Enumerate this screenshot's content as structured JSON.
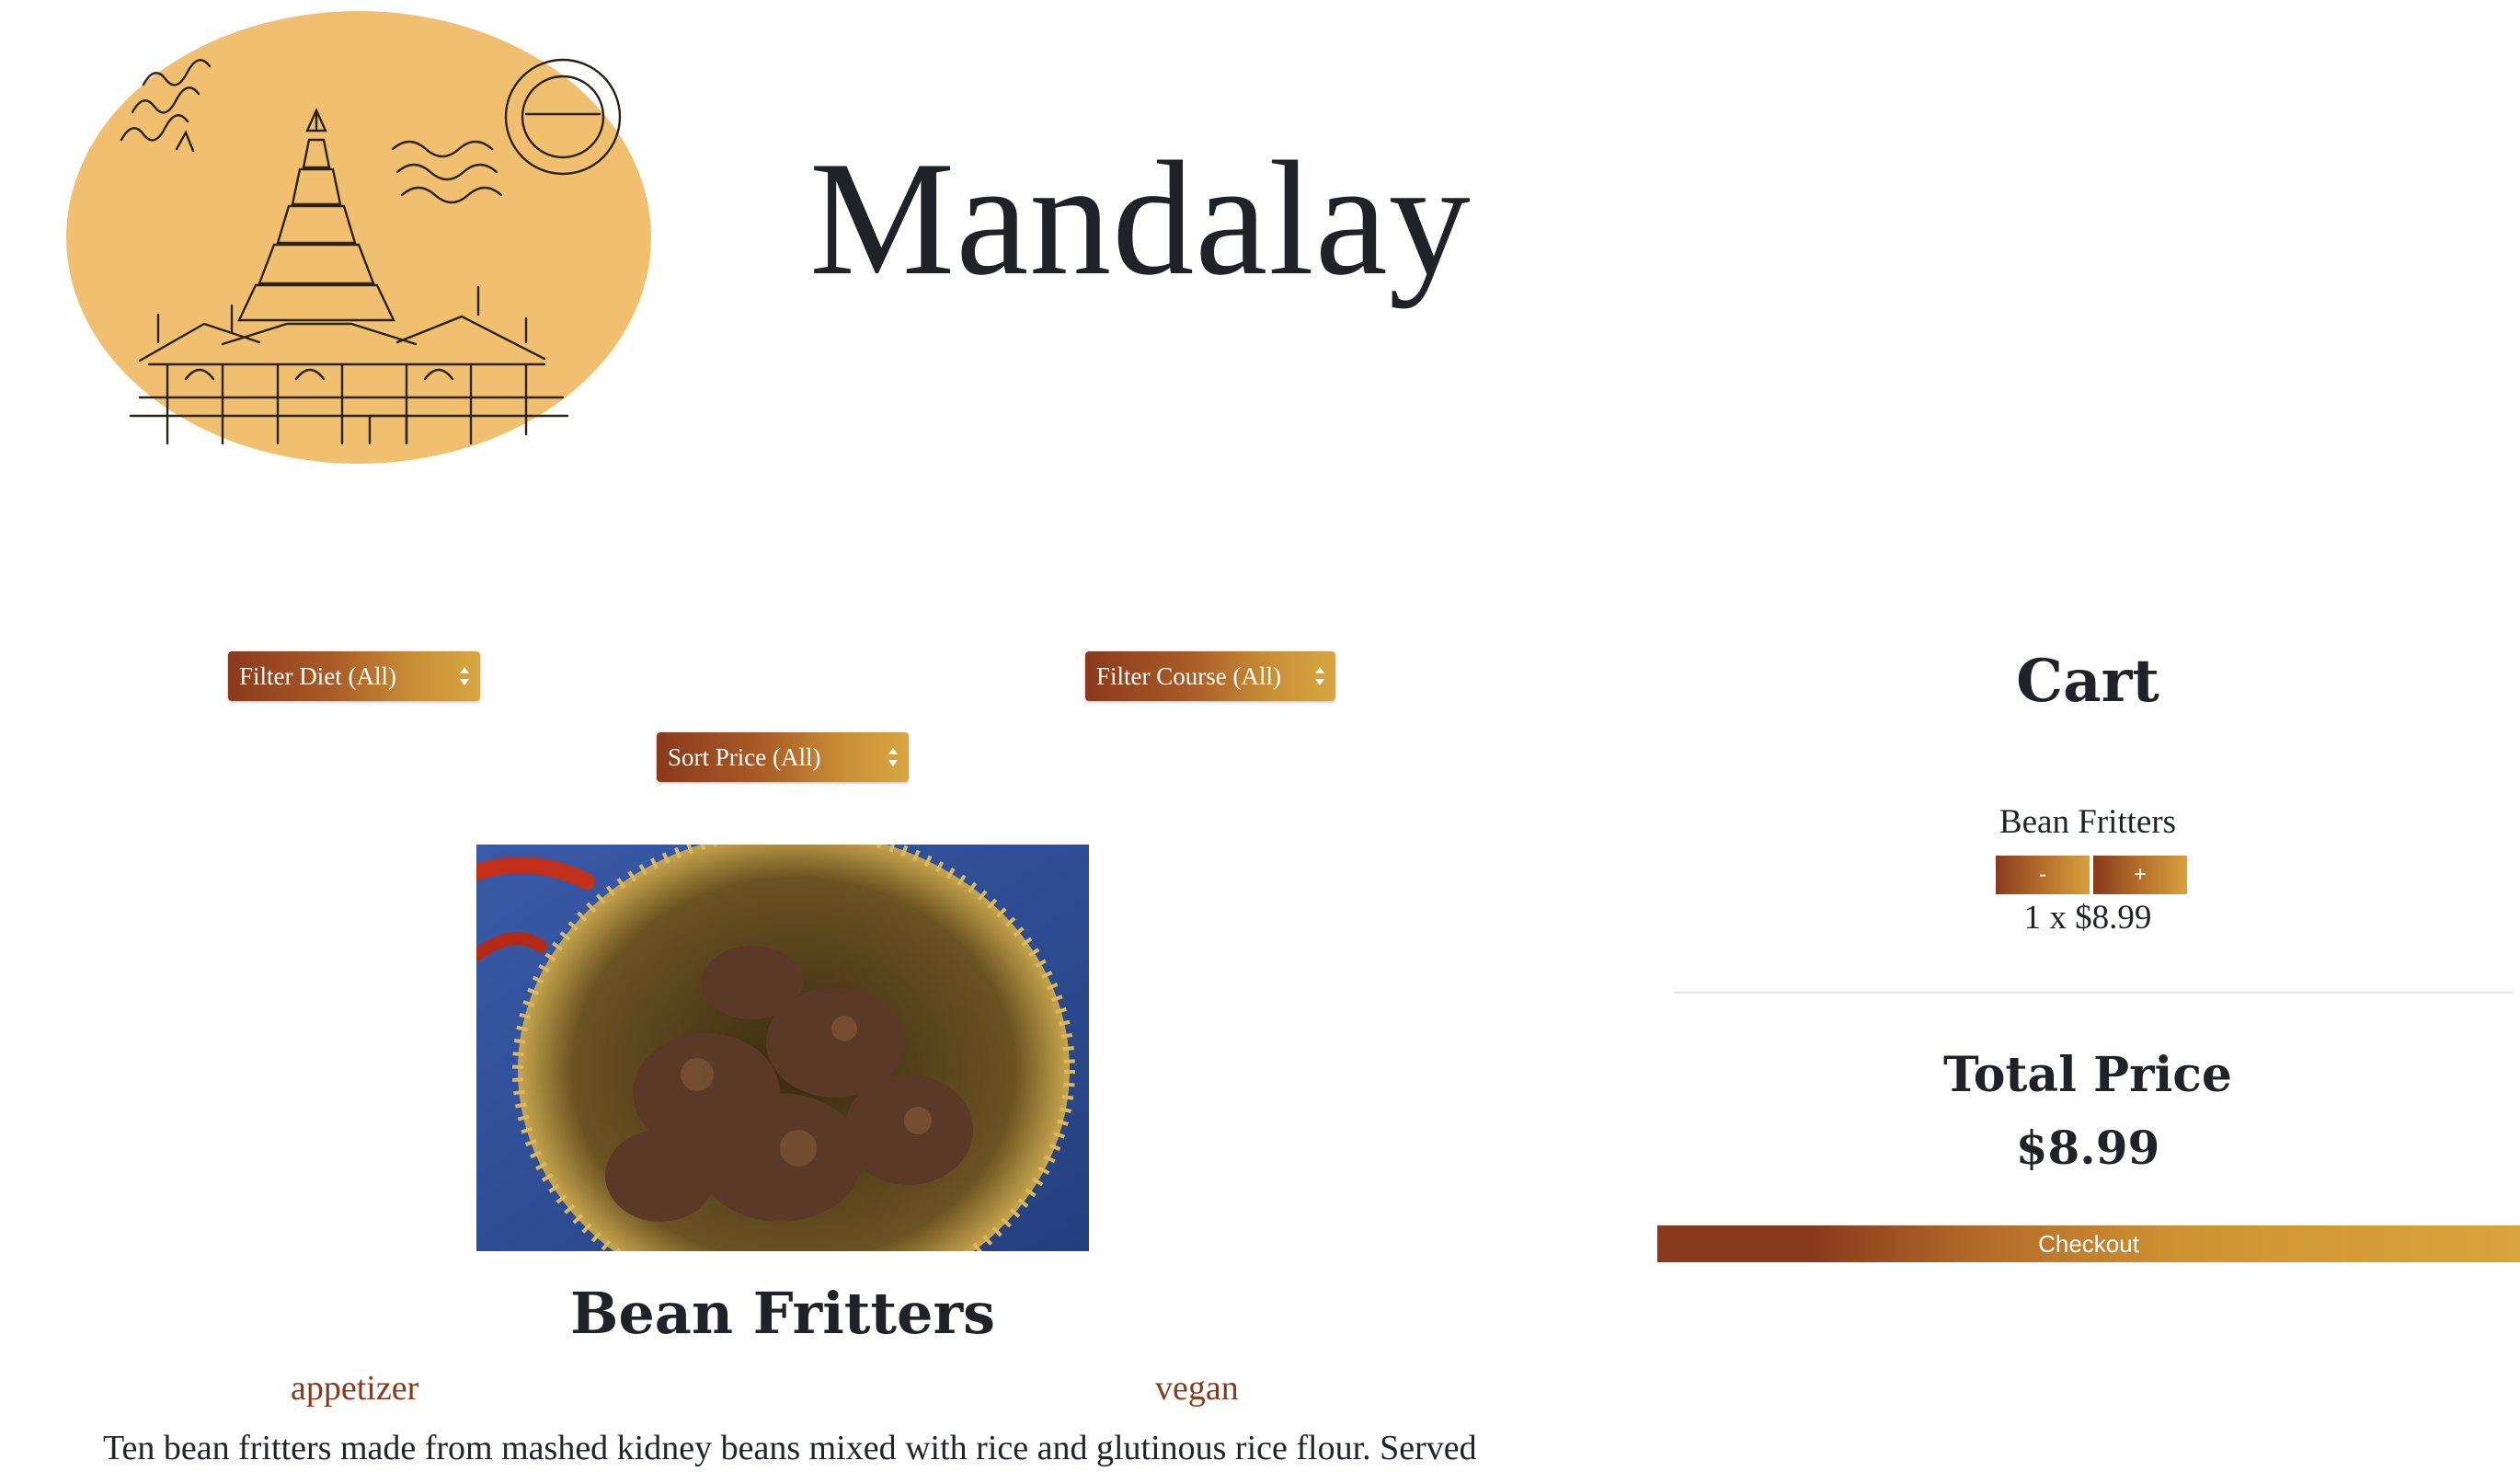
{
  "brand": {
    "name": "Mandalay",
    "logo_icon": "mandalay-palace-postcard-icon",
    "logo_color": "#f0c070"
  },
  "filters": {
    "diet_label": "Filter Diet (All)",
    "course_label": "Filter Course (All)",
    "price_sort_label": "Sort Price (All)"
  },
  "product": {
    "name": "Bean Fritters",
    "image_icon": "bean-fritters-photo",
    "course_tag": "appetizer",
    "diet_tag": "vegan",
    "description": "Ten bean fritters made from mashed kidney beans mixed with rice and glutinous rice flour. Served"
  },
  "cart": {
    "title": "Cart",
    "items": [
      {
        "name": "Bean Fritters",
        "decrease_label": "-",
        "increase_label": "+",
        "line": "1 x $8.99"
      }
    ],
    "total_label": "Total Price",
    "total_value": "$8.99",
    "checkout_label": "Checkout"
  },
  "colors": {
    "accent_dark": "#8a3a1c",
    "accent_gold": "#d8a43c",
    "tag_color": "#8a3a1c"
  }
}
